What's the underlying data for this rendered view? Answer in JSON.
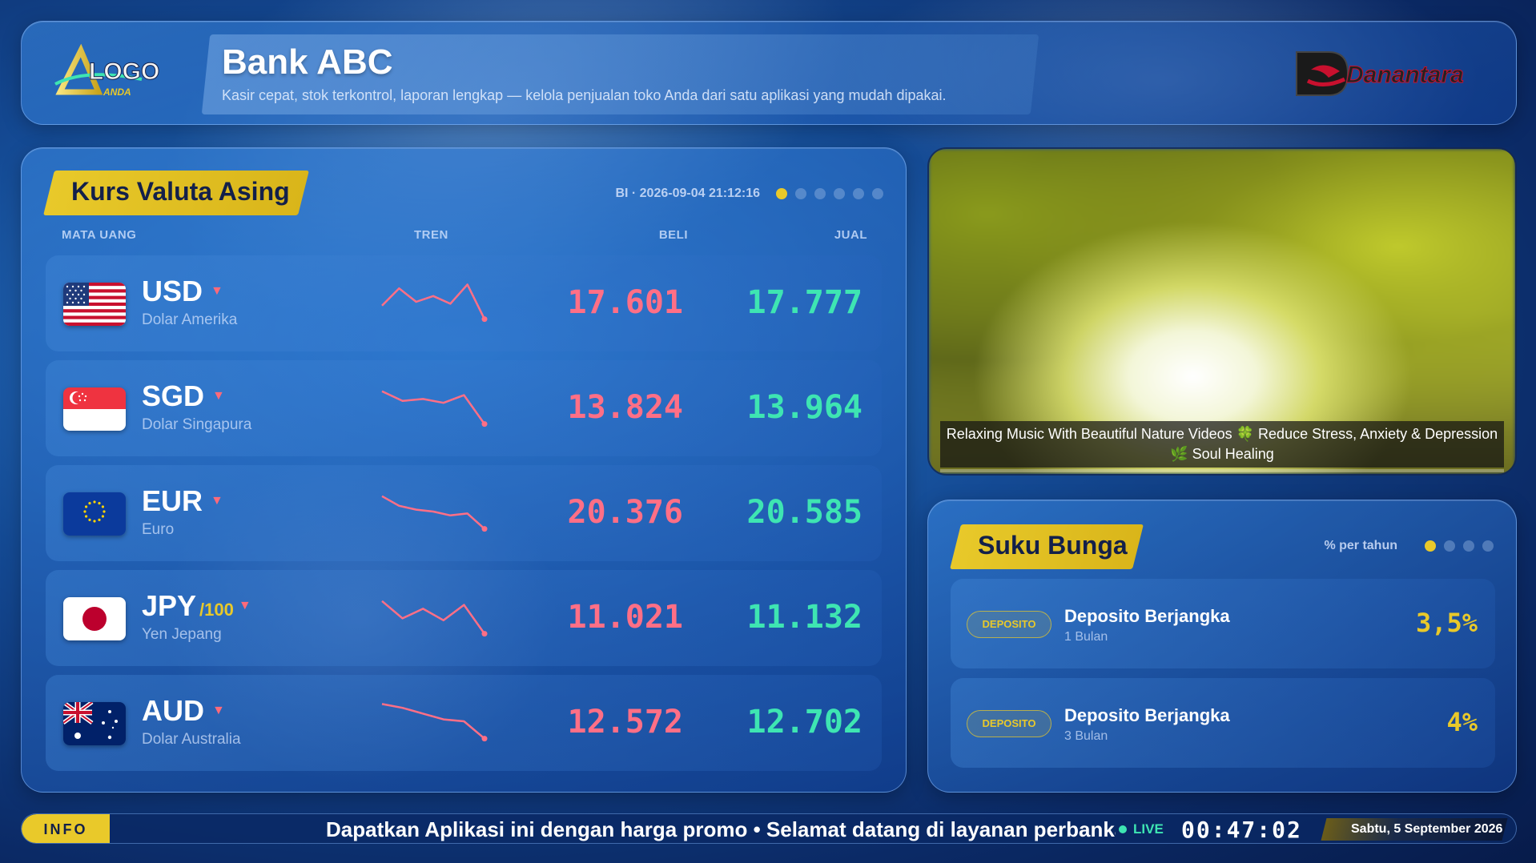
{
  "header": {
    "title": "Bank ABC",
    "subtitle": "Kasir cepat, stok terkontrol, laporan lengkap — kelola penjualan toko Anda dari satu aplikasi yang mudah dipakai.",
    "logo_left_text": "LOGO",
    "logo_left_sub": "ANDA",
    "logo_right_text": "Danantara"
  },
  "fx": {
    "title": "Kurs Valuta Asing",
    "meta": "BI · 2026-09-04 21:12:16",
    "columns": {
      "currency": "MATA UANG",
      "trend": "TREN",
      "buy": "BELI",
      "sell": "JUAL"
    },
    "rows": [
      {
        "code": "USD",
        "unit": "",
        "name": "Dolar Amerika",
        "buy": "17.601",
        "sell": "17.777",
        "trend": [
          0.6,
          0.15,
          0.5,
          0.35,
          0.55,
          0.05,
          0.95
        ]
      },
      {
        "code": "SGD",
        "unit": "",
        "name": "Dolar Singapura",
        "buy": "13.824",
        "sell": "13.964",
        "trend": [
          0.1,
          0.35,
          0.3,
          0.4,
          0.2,
          0.95
        ]
      },
      {
        "code": "EUR",
        "unit": "",
        "name": "Euro",
        "buy": "20.376",
        "sell": "20.585",
        "trend": [
          0.1,
          0.35,
          0.45,
          0.5,
          0.6,
          0.55,
          0.95
        ]
      },
      {
        "code": "JPY",
        "unit": "/100",
        "name": "Yen Jepang",
        "buy": "11.021",
        "sell": "11.132",
        "trend": [
          0.1,
          0.55,
          0.3,
          0.6,
          0.2,
          0.95
        ]
      },
      {
        "code": "AUD",
        "unit": "",
        "name": "Dolar Australia",
        "buy": "12.572",
        "sell": "12.702",
        "trend": [
          0.05,
          0.15,
          0.3,
          0.45,
          0.5,
          0.95
        ]
      }
    ],
    "trend_color": "#ff6f86"
  },
  "video": {
    "caption_line1": "Relaxing Music With Beautiful Nature Videos 🍀 Reduce Stress, Anxiety & Depression",
    "caption_line2": "🌿 Soul Healing"
  },
  "rates": {
    "title": "Suku Bunga",
    "meta": "% per tahun",
    "rows": [
      {
        "tag": "DEPOSITO",
        "title": "Deposito Berjangka",
        "term": "1 Bulan",
        "value": "3,5%"
      },
      {
        "tag": "DEPOSITO",
        "title": "Deposito Berjangka",
        "term": "3 Bulan",
        "value": "4%"
      }
    ]
  },
  "ticker": {
    "label": "INFO",
    "text": "Dapatkan Aplikasi ini dengan harga promo • Selamat datang di layanan perbankan",
    "live": "LIVE",
    "clock": "00:47:02",
    "date": "Sabtu, 5 September 2026"
  },
  "colors": {
    "accent": "#e9c92a",
    "buy": "#ff6f86",
    "sell": "#3ee5b2"
  }
}
